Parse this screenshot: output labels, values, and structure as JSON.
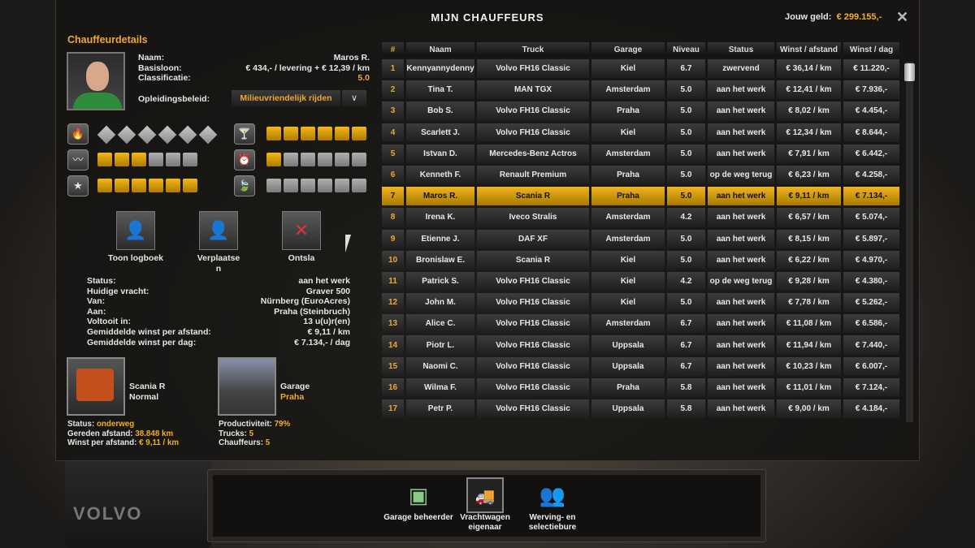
{
  "window": {
    "title": "MIJN CHAUFFEURS",
    "money_label": "Jouw geld:",
    "money_value": "€ 299.155,-",
    "close_icon": "close-icon"
  },
  "details": {
    "heading": "Chauffeurdetails",
    "name_label": "Naam:",
    "name": "Maros R.",
    "salary_label": "Basisloon:",
    "salary": "€ 434,- / levering + € 12,39 / km",
    "rating_label": "Classificatie:",
    "rating": "5.0",
    "training_label": "Opleidingsbeleid:",
    "training_value": "Milieuvriendelijk rijden",
    "skills": [
      {
        "icon": "adr-icon",
        "type": "diamond",
        "level": 0,
        "max": 6
      },
      {
        "icon": "long-distance-icon",
        "type": "bar",
        "level": 3,
        "max": 6
      },
      {
        "icon": "high-value-cargo-icon",
        "type": "bar",
        "level": 6,
        "max": 6
      },
      {
        "icon": "fragile-cargo-icon",
        "type": "bar",
        "level": 6,
        "max": 6
      },
      {
        "icon": "just-in-time-icon",
        "type": "bar",
        "level": 1,
        "max": 6
      },
      {
        "icon": "eco-driving-icon",
        "type": "bar",
        "level": 0,
        "max": 6
      }
    ],
    "actions": {
      "logbook": "Toon logboek",
      "move": "Verplaatsen",
      "fire": "Ontsla"
    },
    "info": [
      {
        "label": "Status:",
        "value": "aan het werk"
      },
      {
        "label": "Huidige vracht:",
        "value": "Graver 500"
      },
      {
        "label": "Van:",
        "value": "Nürnberg (EuroAcres)"
      },
      {
        "label": "Aan:",
        "value": "Praha (Steinbruch)"
      },
      {
        "label": "Voltooit in:",
        "value": "13 u(u)r(en)"
      },
      {
        "label": "Gemiddelde winst per afstand:",
        "value": "€ 9,11 / km"
      },
      {
        "label": "Gemiddelde winst per dag:",
        "value": "€ 7.134,- / dag"
      }
    ],
    "truck": {
      "name": "Scania R",
      "condition": "Normal",
      "status_label": "Status:",
      "status": "onderweg",
      "distance_label": "Gereden afstand:",
      "distance": "38.848 km",
      "profit_label": "Winst per afstand:",
      "profit": "€ 9,11 / km"
    },
    "garage": {
      "label": "Garage",
      "city": "Praha",
      "productivity_label": "Productiviteit:",
      "productivity": "79%",
      "trucks_label": "Trucks:",
      "trucks": "5",
      "drivers_label": "Chauffeurs:",
      "drivers": "5"
    }
  },
  "table": {
    "columns": [
      "#",
      "Naam",
      "Truck",
      "Garage",
      "Niveau",
      "Status",
      "Winst / afstand",
      "Winst / dag"
    ],
    "selected": 7,
    "rows": [
      [
        "1",
        "Kennyannydenny",
        "Volvo FH16 Classic",
        "Kiel",
        "6.7",
        "zwervend",
        "€ 36,14 / km",
        "€ 11.220,-"
      ],
      [
        "2",
        "Tina T.",
        "MAN TGX",
        "Amsterdam",
        "5.0",
        "aan het werk",
        "€ 12,41 / km",
        "€ 7.936,-"
      ],
      [
        "3",
        "Bob S.",
        "Volvo FH16 Classic",
        "Praha",
        "5.0",
        "aan het werk",
        "€ 8,02 / km",
        "€ 4.454,-"
      ],
      [
        "4",
        "Scarlett J.",
        "Volvo FH16 Classic",
        "Kiel",
        "5.0",
        "aan het werk",
        "€ 12,34 / km",
        "€ 8.644,-"
      ],
      [
        "5",
        "Istvan D.",
        "Mercedes-Benz Actros",
        "Amsterdam",
        "5.0",
        "aan het werk",
        "€ 7,91 / km",
        "€ 6.442,-"
      ],
      [
        "6",
        "Kenneth F.",
        "Renault Premium",
        "Praha",
        "5.0",
        "op de weg terug",
        "€ 6,23 / km",
        "€ 4.258,-"
      ],
      [
        "7",
        "Maros R.",
        "Scania R",
        "Praha",
        "5.0",
        "aan het werk",
        "€ 9,11 / km",
        "€ 7.134,-"
      ],
      [
        "8",
        "Irena K.",
        "Iveco Stralis",
        "Amsterdam",
        "4.2",
        "aan het werk",
        "€ 6,57 / km",
        "€ 5.074,-"
      ],
      [
        "9",
        "Etienne J.",
        "DAF XF",
        "Amsterdam",
        "5.0",
        "aan het werk",
        "€ 8,15 / km",
        "€ 5.897,-"
      ],
      [
        "10",
        "Bronislaw E.",
        "Scania R",
        "Kiel",
        "5.0",
        "aan het werk",
        "€ 6,22 / km",
        "€ 4.970,-"
      ],
      [
        "11",
        "Patrick S.",
        "Volvo FH16 Classic",
        "Kiel",
        "4.2",
        "op de weg terug",
        "€ 9,28 / km",
        "€ 4.380,-"
      ],
      [
        "12",
        "John M.",
        "Volvo FH16 Classic",
        "Kiel",
        "5.0",
        "aan het werk",
        "€ 7,78 / km",
        "€ 5.262,-"
      ],
      [
        "13",
        "Alice C.",
        "Volvo FH16 Classic",
        "Amsterdam",
        "6.7",
        "aan het werk",
        "€ 11,08 / km",
        "€ 6.586,-"
      ],
      [
        "14",
        "Piotr L.",
        "Volvo FH16 Classic",
        "Uppsala",
        "6.7",
        "aan het werk",
        "€ 11,94 / km",
        "€ 7.440,-"
      ],
      [
        "15",
        "Naomi C.",
        "Volvo FH16 Classic",
        "Uppsala",
        "6.7",
        "aan het werk",
        "€ 10,23 / km",
        "€ 6.007,-"
      ],
      [
        "16",
        "Wilma F.",
        "Volvo FH16 Classic",
        "Praha",
        "5.8",
        "aan het werk",
        "€ 11,01 / km",
        "€ 7.124,-"
      ],
      [
        "17",
        "Petr P.",
        "Volvo FH16 Classic",
        "Uppsala",
        "5.8",
        "aan het werk",
        "€ 9,00 / km",
        "€ 4.184,-"
      ]
    ]
  },
  "bottom": [
    {
      "label": "Garage beheerder",
      "icon": "garage-manager-icon"
    },
    {
      "label": "Vrachtwagen eigenaar",
      "icon": "truck-owner-icon"
    },
    {
      "label": "Werving- en selectiebure",
      "icon": "recruitment-icon"
    }
  ],
  "background": {
    "logo": "VOLVO"
  },
  "colors": {
    "accent": "#f0a830",
    "selected_row": "#f0b420"
  }
}
